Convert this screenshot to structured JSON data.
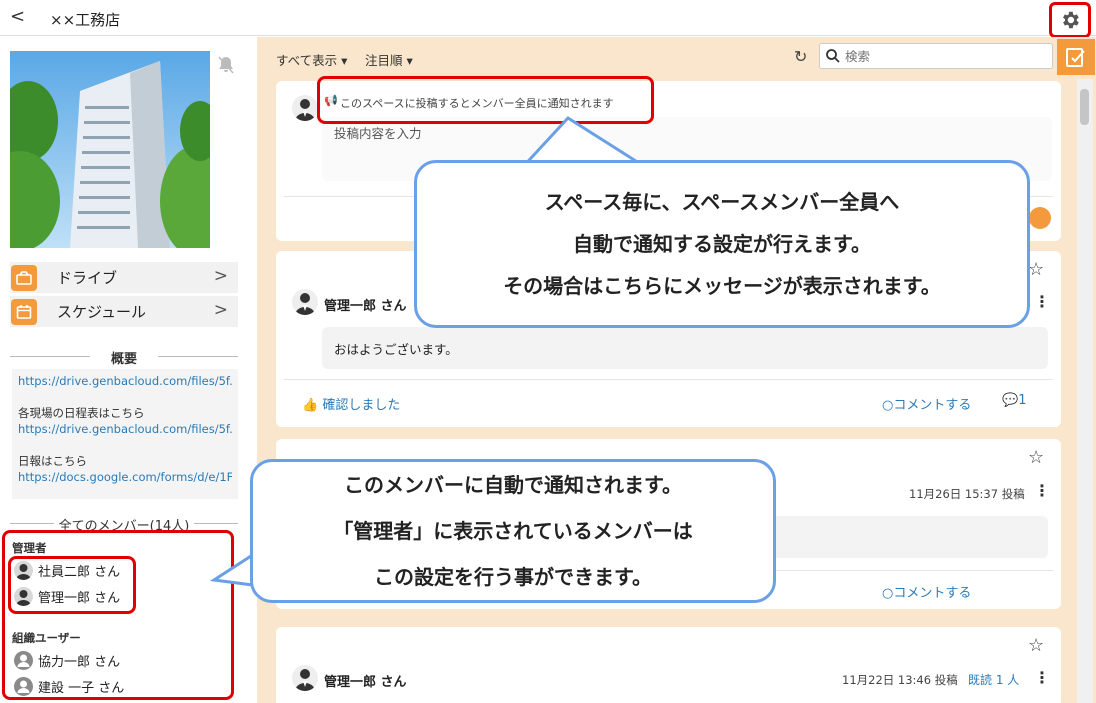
{
  "header": {
    "back_label": "<",
    "title": "××工務店"
  },
  "sidebar": {
    "drive_label": "ドライブ",
    "schedule_label": "スケジュール",
    "overview_title": "概要",
    "overview_lines": [
      "https://drive.genbacloud.com/files/5f...",
      "各現場の日程表はこちら",
      "https://drive.genbacloud.com/files/5f...",
      "日報はこちら",
      "https://docs.google.com/forms/d/e/1F..."
    ],
    "members_title": "全てのメンバー(14人)",
    "group_admin": "管理者",
    "admins": [
      "社員二郎 さん",
      "管理一郎 さん"
    ],
    "group_org": "組織ユーザー",
    "org_users": [
      "協力一郎 さん",
      "建設 一子 さん"
    ]
  },
  "toolbar": {
    "show_all": "すべて表示 ▾",
    "sort": "注目順 ▾",
    "search_placeholder": "検索"
  },
  "composer": {
    "notice": "このスペースに投稿するとメンバー全員に通知されます",
    "placeholder": "投稿内容を入力"
  },
  "posts": [
    {
      "author": "管理一郎 さん",
      "body": "おはようございます。",
      "confirm": "確認しました",
      "comment": "コメントする",
      "comment_count": "1"
    },
    {
      "meta": "11月26日 15:37  投稿",
      "comment": "コメントする"
    },
    {
      "author": "管理一郎 さん",
      "meta": "11月22日 13:46  投稿",
      "read": "既読 1 人"
    }
  ],
  "callouts": {
    "top": [
      "スペース毎に、スペースメンバー全員へ",
      "自動で通知する設定が行えます。",
      "その場合はこちらにメッセージが表示されます。"
    ],
    "bottom": [
      "このメンバーに自動で通知されます。",
      "「管理者」に表示されているメンバーは",
      "この設定を行う事ができます。"
    ]
  },
  "colors": {
    "accent_orange": "#f39a3c",
    "highlight_red": "#e00000",
    "callout_border": "#6aa0e6",
    "main_bg": "#fae6cc",
    "link_blue": "#2a7ab8"
  }
}
